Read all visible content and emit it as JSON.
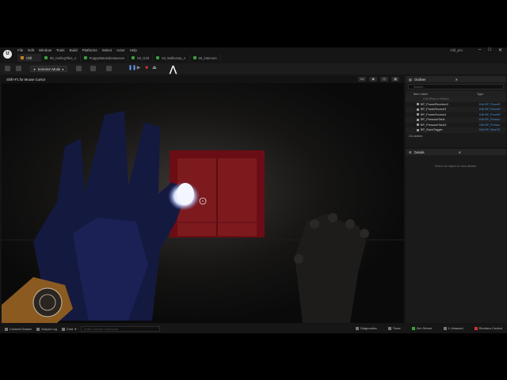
{
  "window": {
    "project_name": "chll_pro",
    "logo_text": "U",
    "menu": [
      "File",
      "Edit",
      "Window",
      "Tools",
      "Build",
      "Platforms",
      "Select",
      "Actor",
      "Help"
    ],
    "controls": [
      "–",
      "□",
      "✕"
    ]
  },
  "tabs": [
    {
      "label": "Chll",
      "active": true,
      "kind": "level"
    },
    {
      "label": "MI_CeilingTiles_A",
      "active": false,
      "kind": "material"
    },
    {
      "label": "PoppyMaterialInstances",
      "active": false,
      "kind": "material"
    },
    {
      "label": "MI_Grid",
      "active": false,
      "kind": "material"
    },
    {
      "label": "MI_Wallcamp_A",
      "active": false,
      "kind": "material"
    },
    {
      "label": "MI_intercom",
      "active": false,
      "kind": "material"
    }
  ],
  "toolbar": {
    "selection_mode": "Selection Mode",
    "play_controls": [
      "pause-icon",
      "play-icon",
      "stop-icon",
      "eject-icon"
    ],
    "colors": {
      "stop": "#d33",
      "pause": "#6aa0ff",
      "play": "#888"
    }
  },
  "viewport": {
    "hint": "Shift+F1 for Mouse Cursor",
    "icons": [
      "Lit",
      "Show",
      "Cam",
      "Snap"
    ]
  },
  "outliner": {
    "title": "Outliner",
    "search_placeholder": "Search...",
    "columns": [
      "Item Label",
      "Type"
    ],
    "world_row": "Chll (Play In Editor)",
    "items": [
      {
        "name": "BP_PowerReceiver2",
        "type": "Edit BP_PowerR"
      },
      {
        "name": "BP_PowerSource3",
        "type": "Edit BP_PowerR"
      },
      {
        "name": "BP_PowerSource4",
        "type": "Edit BP_PowerR"
      },
      {
        "name": "BP_PressureTank",
        "type": "Edit BP_Pressur"
      },
      {
        "name": "BP_PressureTank2",
        "type": "Edit BP_Pressur"
      },
      {
        "name": "BP_SaveTrigger",
        "type": "Edit BP_SaveTri"
      }
    ],
    "actor_count": "211 actors"
  },
  "details": {
    "title": "Details",
    "empty_message": "Select an object to view details."
  },
  "statusbar": {
    "content_drawer": "Content Drawer",
    "output_log": "Output Log",
    "cmd_label": "Cmd",
    "cmd_placeholder": "Enter Console Command",
    "diagnostics": "Diagnostics",
    "trace": "Trace",
    "derived_data": "Zen Server",
    "unsaved": "1 Unsaved",
    "revision": "Revision Control"
  }
}
